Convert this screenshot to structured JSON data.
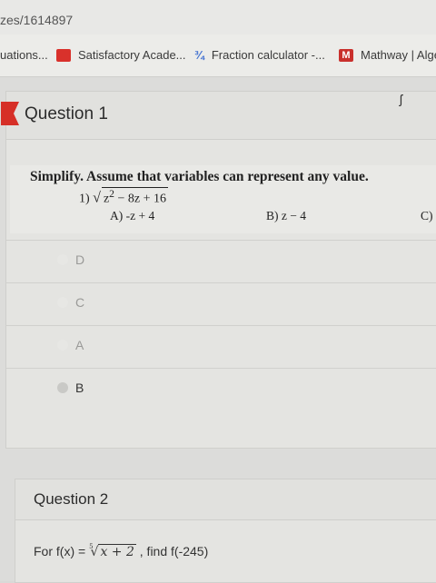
{
  "browser": {
    "address": "zes/1614897",
    "bookmarks": [
      {
        "label": "uations...",
        "icon": "none"
      },
      {
        "label": "Satisfactory Acade...",
        "icon": "satisfactory-academy-icon"
      },
      {
        "label": "Fraction calculator -...",
        "icon": "fraction-icon",
        "glyph": "¾"
      },
      {
        "label": "Mathway | Alge",
        "icon": "mathway-icon",
        "glyph": "M"
      }
    ]
  },
  "question1": {
    "title": "Question 1",
    "corner_mark": "ʃ",
    "prompt": "Simplify. Assume that variables can represent any value.",
    "problem_number": "1)",
    "radicand_base": "z",
    "radicand_exp": "2",
    "radicand_rest": " − 8z + 16",
    "choices": {
      "a": "A) -z + 4",
      "b": "B) z − 4",
      "c": "C) i"
    },
    "options": [
      {
        "label": "D",
        "selected": false
      },
      {
        "label": "C",
        "selected": false
      },
      {
        "label": "A",
        "selected": false
      },
      {
        "label": "B",
        "selected": true
      }
    ]
  },
  "question2": {
    "title": "Question 2",
    "text_before": "For f(x) = ",
    "root_index": "5",
    "radicand": "x + 2",
    "text_after": " , find f(-245)"
  },
  "colors": {
    "flag": "#d62f27",
    "background": "#dcdcda"
  }
}
